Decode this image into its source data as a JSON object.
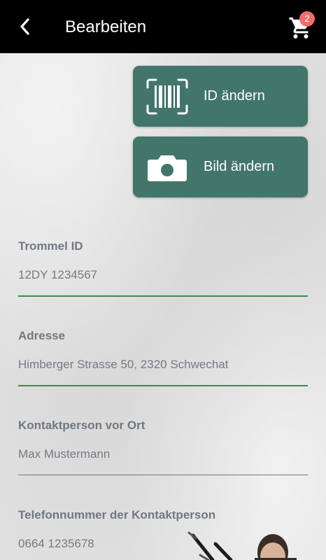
{
  "header": {
    "title": "Bearbeiten",
    "cart_count": "2",
    "back_icon": "chevron-left-icon",
    "cart_icon": "shopping-cart-icon"
  },
  "actions": {
    "change_id": {
      "label": "ID ändern",
      "icon": "barcode-scan-icon"
    },
    "change_image": {
      "label": "Bild ändern",
      "icon": "camera-icon"
    }
  },
  "fields": [
    {
      "label": "Trommel ID",
      "value": "12DY 1234567"
    },
    {
      "label": "Adresse",
      "value": "Himberger Strasse 50, 2320 Schwechat"
    },
    {
      "label": "Kontaktperson vor Ort",
      "value": "Max Mustermann"
    },
    {
      "label": "Telefonnummer der Kontaktperson",
      "value": "0664 1235678"
    }
  ],
  "colors": {
    "accent": "#42766a",
    "underline_active": "#3b8d48",
    "badge": "#f26d6d",
    "appbar": "#000000"
  }
}
